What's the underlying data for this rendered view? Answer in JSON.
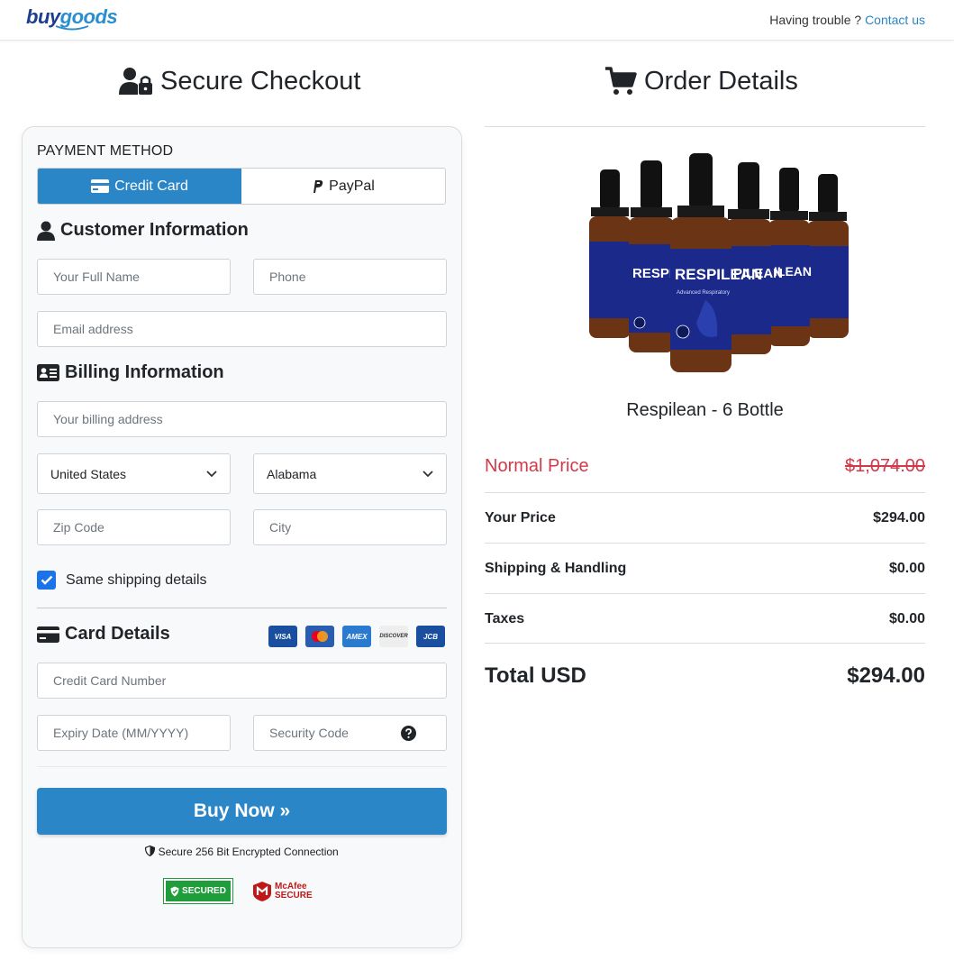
{
  "header": {
    "logo_part1": "buy",
    "logo_part2": "goods",
    "trouble_text": "Having trouble ?",
    "contact_link": "Contact us"
  },
  "checkout": {
    "title": "Secure Checkout",
    "payment_method_label": "PAYMENT METHOD",
    "tabs": [
      {
        "label": "Credit Card",
        "active": true
      },
      {
        "label": "PayPal",
        "active": false
      }
    ],
    "customer_info": {
      "title": "Customer Information",
      "full_name_placeholder": "Your Full Name",
      "phone_placeholder": "Phone",
      "email_placeholder": "Email address"
    },
    "billing_info": {
      "title": "Billing Information",
      "address_placeholder": "Your billing address",
      "country_value": "United States",
      "state_value": "Alabama",
      "zip_placeholder": "Zip Code",
      "city_placeholder": "City",
      "same_shipping_label": "Same shipping details",
      "same_shipping_checked": true
    },
    "card_details": {
      "title": "Card Details",
      "card_brands": [
        "VISA",
        "MC",
        "AMEX",
        "DISCOVER",
        "JCB"
      ],
      "card_number_placeholder": "Credit Card Number",
      "expiry_placeholder": "Expiry Date (MM/YYYY)",
      "security_placeholder": "Security Code"
    },
    "buy_button": "Buy Now »",
    "secure_note": "Secure 256 Bit Encrypted Connection",
    "trust_badges": [
      "SECURED",
      "McAfee SECURE"
    ]
  },
  "order": {
    "title": "Order Details",
    "product_name": "Respilean - 6 Bottle",
    "normal_price_label": "Normal Price",
    "normal_price_value": "$1,074.00",
    "your_price_label": "Your Price",
    "your_price_value": "$294.00",
    "shipping_label": "Shipping & Handling",
    "shipping_value": "$0.00",
    "taxes_label": "Taxes",
    "taxes_value": "$0.00",
    "total_label": "Total USD",
    "total_value": "$294.00"
  },
  "colors": {
    "primary": "#2a86c6",
    "strike_red": "#d23a4a",
    "checkbox_blue": "#1a73e8"
  }
}
